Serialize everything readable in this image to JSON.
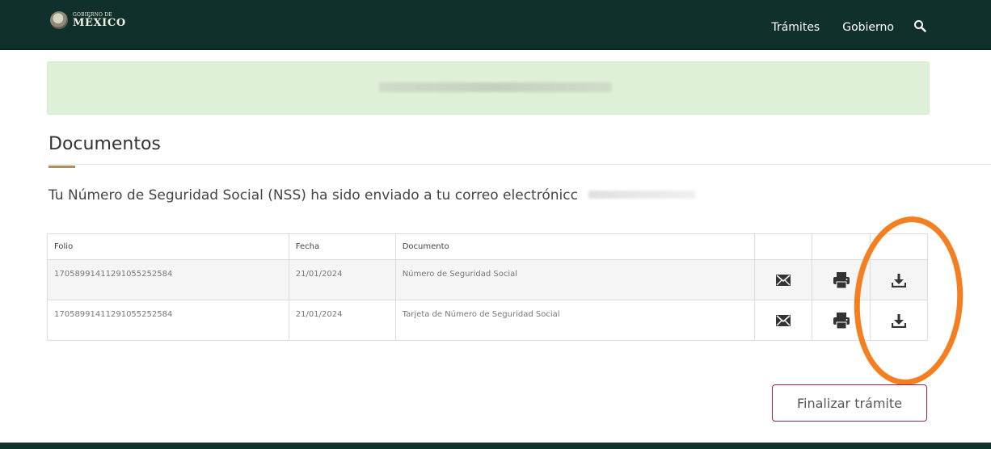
{
  "header": {
    "logo_small": "GOBIERNO DE",
    "logo_main": "MÉXICO",
    "nav": [
      {
        "label": "Trámites"
      },
      {
        "label": "Gobierno"
      }
    ],
    "search_icon": "search-icon"
  },
  "section": {
    "title": "Documentos",
    "message": "Tu Número de Seguridad Social (NSS) ha sido enviado a tu correo electrónicc"
  },
  "table": {
    "headers": [
      "Folio",
      "Fecha",
      "Documento",
      "",
      "",
      ""
    ],
    "rows": [
      {
        "folio": "17058991411291055252584",
        "fecha": "21/01/2024",
        "documento": "Número de Seguridad Social"
      },
      {
        "folio": "17058991411291055252584",
        "fecha": "21/01/2024",
        "documento": "Tarjeta de Número de Seguridad Social"
      }
    ],
    "action_icons": [
      "envelope-icon",
      "print-icon",
      "download-icon"
    ]
  },
  "buttons": {
    "finish": "Finalizar trámite"
  },
  "colors": {
    "header_bg": "#10312b",
    "alert_bg": "#dff0d8",
    "accent_gold": "#b38e5d",
    "button_border": "#9d2449",
    "annotation": "#f47f20"
  }
}
